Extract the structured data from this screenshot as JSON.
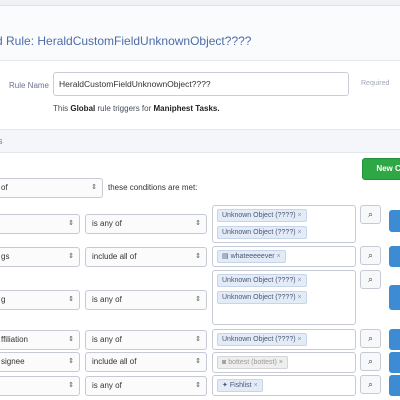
{
  "page": {
    "title": "d Rule: HeraldCustomFieldUnknownObject????"
  },
  "form": {
    "rule_name_label": "Rule Name",
    "rule_name_value": "HeraldCustomFieldUnknownObject????",
    "required_label": "Required",
    "note_prefix": "This ",
    "note_global": "Global",
    "note_middle": " rule triggers for ",
    "note_target": "Maniphest Tasks."
  },
  "section": {
    "label": "s"
  },
  "toolbar": {
    "new_condition_label": "New Co"
  },
  "match": {
    "value": "of",
    "suffix": "these conditions are met:"
  },
  "conditions": [
    {
      "field": "",
      "op": "is any of",
      "tokens": [
        {
          "label": "Unknown Object (????)",
          "style": "blue"
        },
        {
          "label": "Unknown Object (????)",
          "style": "blue"
        }
      ]
    },
    {
      "field": "gs",
      "op": "include all of",
      "tokens": [
        {
          "label": "whateeeeever",
          "style": "blue",
          "icon": "tag-icon"
        }
      ]
    },
    {
      "field": "g",
      "op": "is any of",
      "tokens": [
        {
          "label": "Unknown Object (????)",
          "style": "blue"
        },
        {
          "label": "Unknown Object (????)",
          "style": "blue"
        }
      ]
    },
    {
      "field": "ffiliation",
      "op": "is any of",
      "tokens": [
        {
          "label": "Unknown Object (????)",
          "style": "blue"
        }
      ]
    },
    {
      "field": "signee",
      "op": "include all of",
      "tokens": [
        {
          "label": "bottest (bottest)",
          "style": "gray",
          "icon": "user-icon"
        }
      ]
    },
    {
      "field": "",
      "op": "is any of",
      "tokens": [
        {
          "label": "Fishlist",
          "style": "blue",
          "icon": "star-icon"
        }
      ]
    }
  ],
  "icons": {
    "caret": "updown-caret-icon",
    "search": "magnifier-icon"
  },
  "colors": {
    "accent_green": "#2ea844",
    "accent_blue": "#3c8bd3",
    "token_blue": "#e3ebf7",
    "title_blue": "#4d6ca8"
  }
}
